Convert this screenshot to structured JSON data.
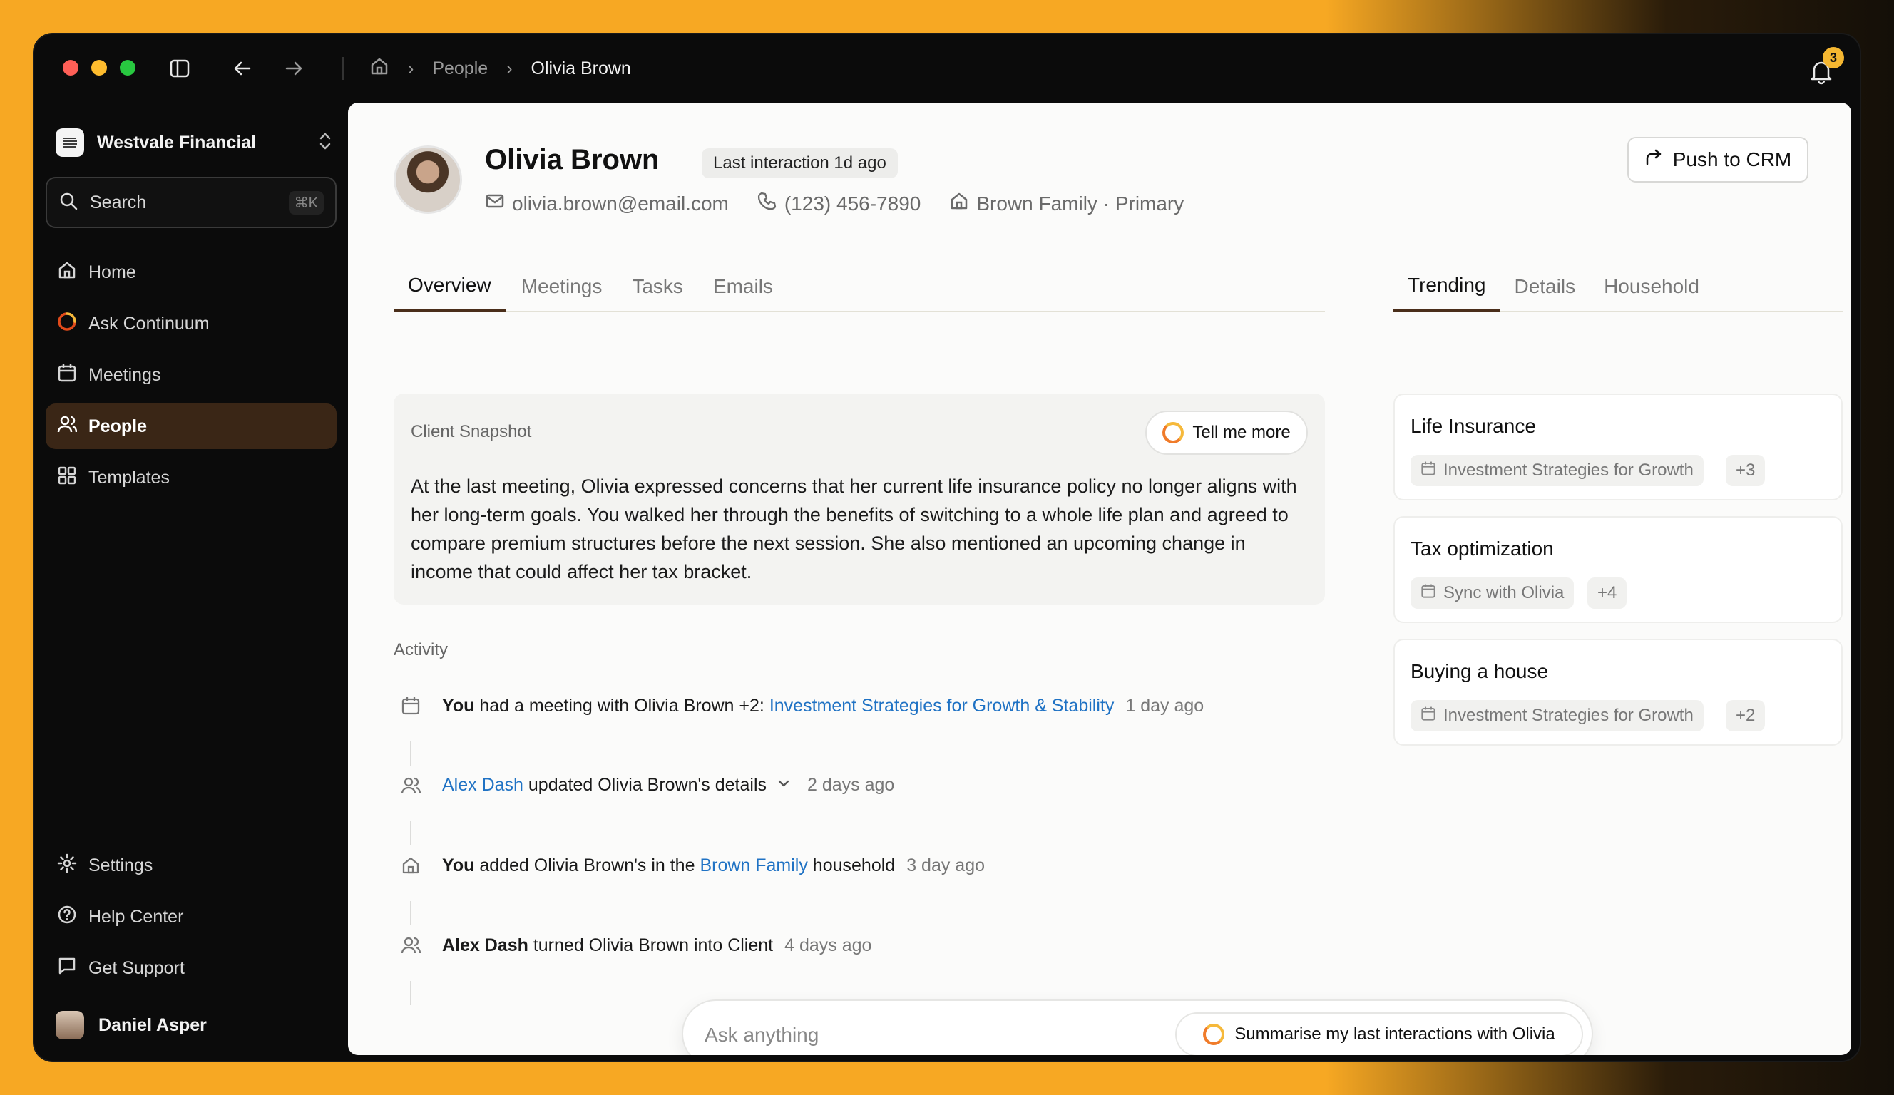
{
  "breadcrumb": {
    "section": "People",
    "current": "Olivia Brown"
  },
  "notifications": {
    "count": "3"
  },
  "sidebar": {
    "org_name": "Westvale Financial",
    "search_label": "Search",
    "search_shortcut": "⌘K",
    "items": [
      {
        "label": "Home",
        "icon": "home-icon"
      },
      {
        "label": "Ask Continuum",
        "icon": "continuum-icon"
      },
      {
        "label": "Meetings",
        "icon": "calendar-icon"
      },
      {
        "label": "People",
        "icon": "people-icon",
        "active": true
      },
      {
        "label": "Templates",
        "icon": "grid-icon"
      }
    ],
    "bottom_items": [
      {
        "label": "Settings",
        "icon": "gear-icon"
      },
      {
        "label": "Help Center",
        "icon": "help-icon"
      },
      {
        "label": "Get Support",
        "icon": "chat-icon"
      }
    ],
    "user_name": "Daniel Asper"
  },
  "profile": {
    "name": "Olivia Brown",
    "last_interaction": "Last interaction 1d ago",
    "email": "olivia.brown@email.com",
    "phone": "(123) 456-7890",
    "household": "Brown Family · Primary",
    "push_label": "Push to CRM"
  },
  "tabs": [
    "Overview",
    "Meetings",
    "Tasks",
    "Emails"
  ],
  "side_tabs": [
    "Trending",
    "Details",
    "Household"
  ],
  "snapshot": {
    "title": "Client Snapshot",
    "button": "Tell me more",
    "text": "At the last meeting, Olivia expressed concerns that her current life insurance policy no longer aligns with her long-term goals. You walked her through the benefits of switching to a whole life plan and agreed to compare premium structures before the next session. She also mentioned an upcoming change in income that could affect her tax bracket."
  },
  "activity": {
    "title": "Activity",
    "items": [
      {
        "actor": "You",
        "pre": " had a meeting with ",
        "bold2": "Olivia Brown +2",
        "mid": ": ",
        "link": "Investment Strategies for Growth & Stability",
        "post": "",
        "time": "1 day ago"
      },
      {
        "actor": "Alex Dash",
        "pre": " updated Olivia Brown's details",
        "time": "2 days ago"
      },
      {
        "actor": "You",
        "pre": " added Olivia Brown's in the ",
        "link": "Brown Family",
        "post": " household",
        "time": "3 day ago"
      },
      {
        "actor": "Alex Dash",
        "pre": " turned ",
        "bold2": "Olivia Brown",
        "post": " into Client",
        "time": "4 days ago"
      }
    ]
  },
  "trending": [
    {
      "title": "Life Insurance",
      "chip": "Investment Strategies for Growth",
      "more": "+3"
    },
    {
      "title": "Tax optimization",
      "chip": "Sync with Olivia",
      "more": "+4"
    },
    {
      "title": "Buying a house",
      "chip": "Investment Strategies for Growth",
      "more": "+2"
    }
  ],
  "ask": {
    "placeholder": "Ask anything",
    "suggestion": "Summarise my last interactions with Olivia"
  },
  "colors": {
    "accent_brown": "#3a2616",
    "link_blue": "#1f72c4",
    "badge_yellow": "#f5b731"
  }
}
